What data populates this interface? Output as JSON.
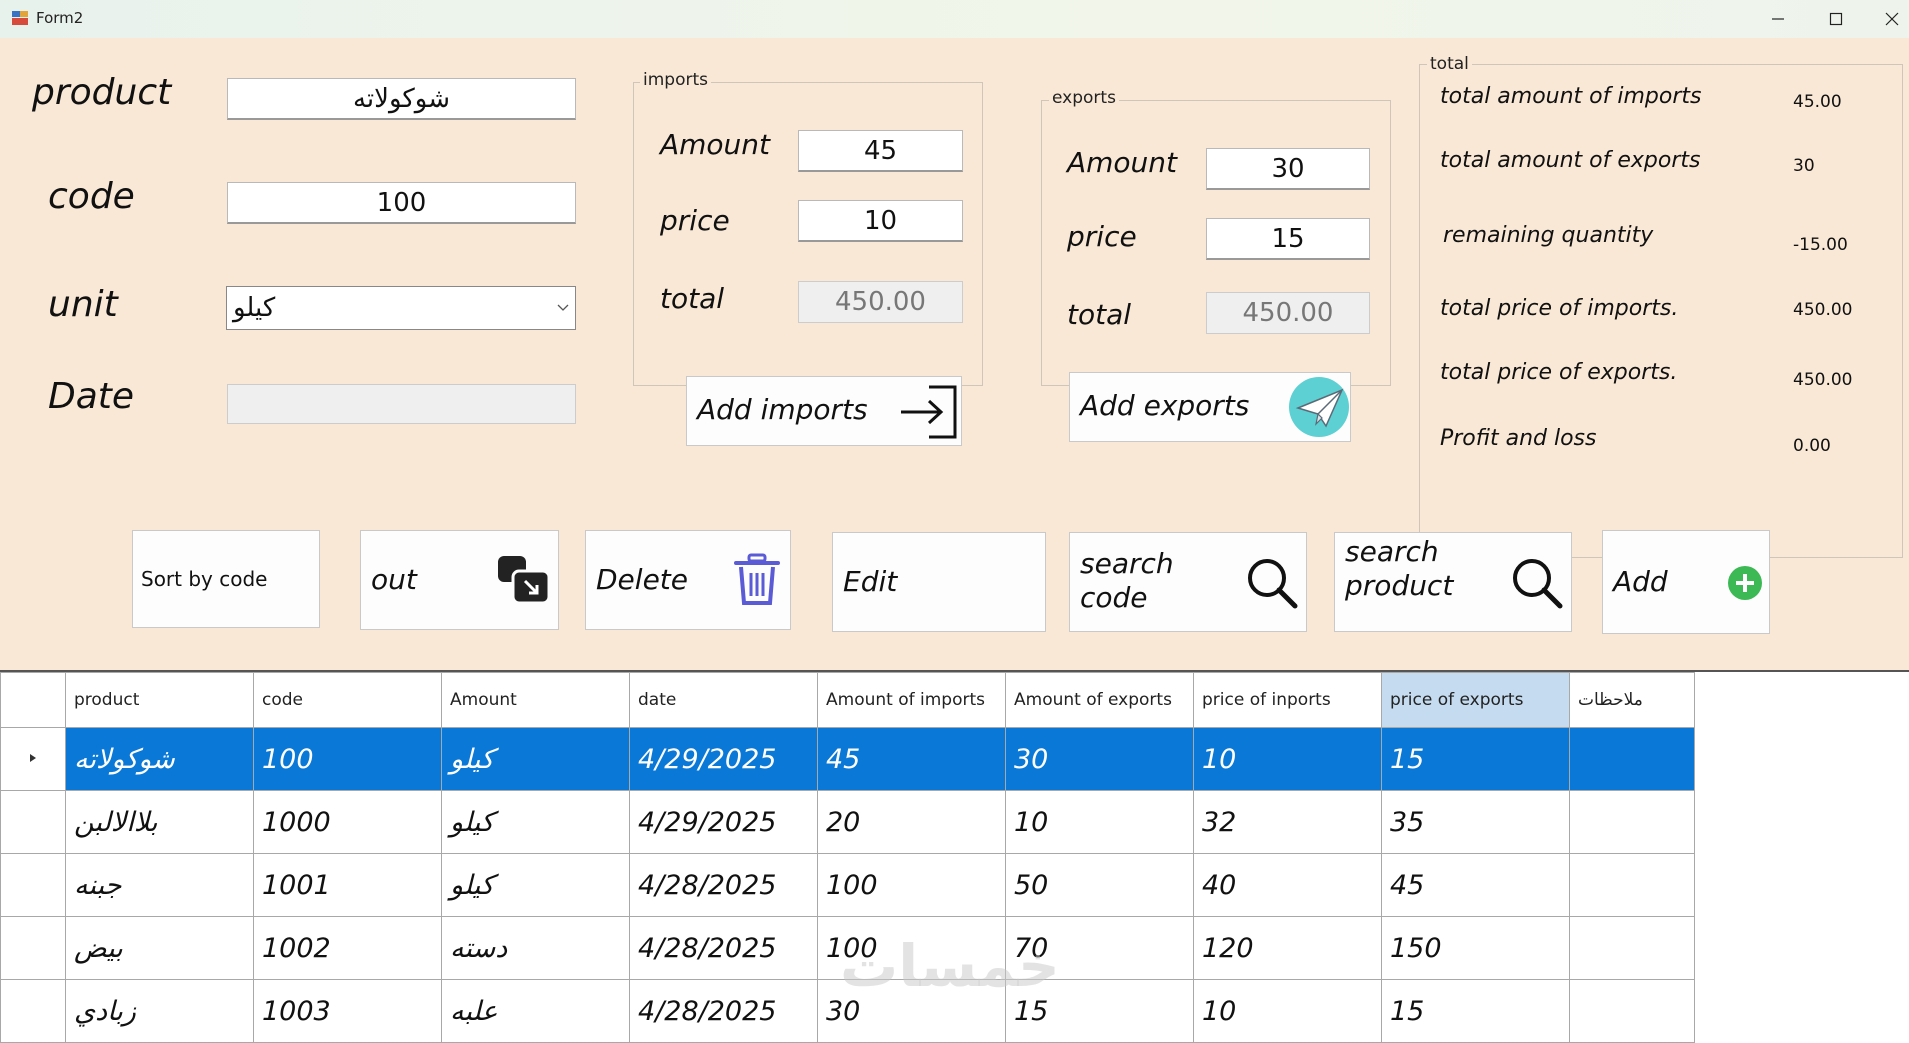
{
  "window": {
    "title": "Form2"
  },
  "form": {
    "product_label": "product",
    "product_value": "شوكولاته",
    "code_label": "code",
    "code_value": "100",
    "unit_label": "unit",
    "unit_value": "كيلو",
    "date_label": "Date",
    "date_value": ""
  },
  "imports": {
    "group_title": "imports",
    "amount_label": "Amount",
    "amount_value": "45",
    "price_label": "price",
    "price_value": "10",
    "total_label": "total",
    "total_value": "450.00",
    "add_button": "Add imports"
  },
  "exports": {
    "group_title": "exports",
    "amount_label": "Amount",
    "amount_value": "30",
    "price_label": "price",
    "price_value": "15",
    "total_label": "total",
    "total_value": "450.00",
    "add_button": "Add exports"
  },
  "totals": {
    "group_title": "total",
    "items": [
      {
        "label": "total amount of imports",
        "value": "45.00"
      },
      {
        "label": "total amount of exports",
        "value": "30"
      },
      {
        "label": "remaining quantity",
        "value": "-15.00"
      },
      {
        "label": "total price of imports.",
        "value": "450.00"
      },
      {
        "label": "total price of exports.",
        "value": "450.00"
      },
      {
        "label": "Profit and loss",
        "value": "0.00"
      }
    ]
  },
  "toolbar": {
    "sort_by_code": "Sort by code",
    "out": "out",
    "delete": "Delete",
    "edit": "Edit",
    "search_code_1": "search",
    "search_code_2": "code",
    "search_product_1": "search",
    "search_product_2": "product",
    "add": "Add"
  },
  "grid": {
    "columns": [
      "product",
      "code",
      "Amount",
      "date",
      "Amount of imports",
      "Amount of exports",
      "price of inports",
      "price of exports",
      "ملاحظات"
    ],
    "rows": [
      [
        "شوكولاته",
        "100",
        "كيلو",
        "4/29/2025",
        "45",
        "30",
        "10",
        "15",
        ""
      ],
      [
        "بلاالالبن",
        "1000",
        "كيلو",
        "4/29/2025",
        "20",
        "10",
        "32",
        "35",
        ""
      ],
      [
        "جبنه",
        "1001",
        "كيلو",
        "4/28/2025",
        "100",
        "50",
        "40",
        "45",
        ""
      ],
      [
        "بيض",
        "1002",
        "دسته",
        "4/28/2025",
        "100",
        "70",
        "120",
        "150",
        ""
      ],
      [
        "زبادي",
        "1003",
        "علبه",
        "4/28/2025",
        "30",
        "15",
        "10",
        "15",
        ""
      ]
    ]
  },
  "watermark": "خمسات"
}
